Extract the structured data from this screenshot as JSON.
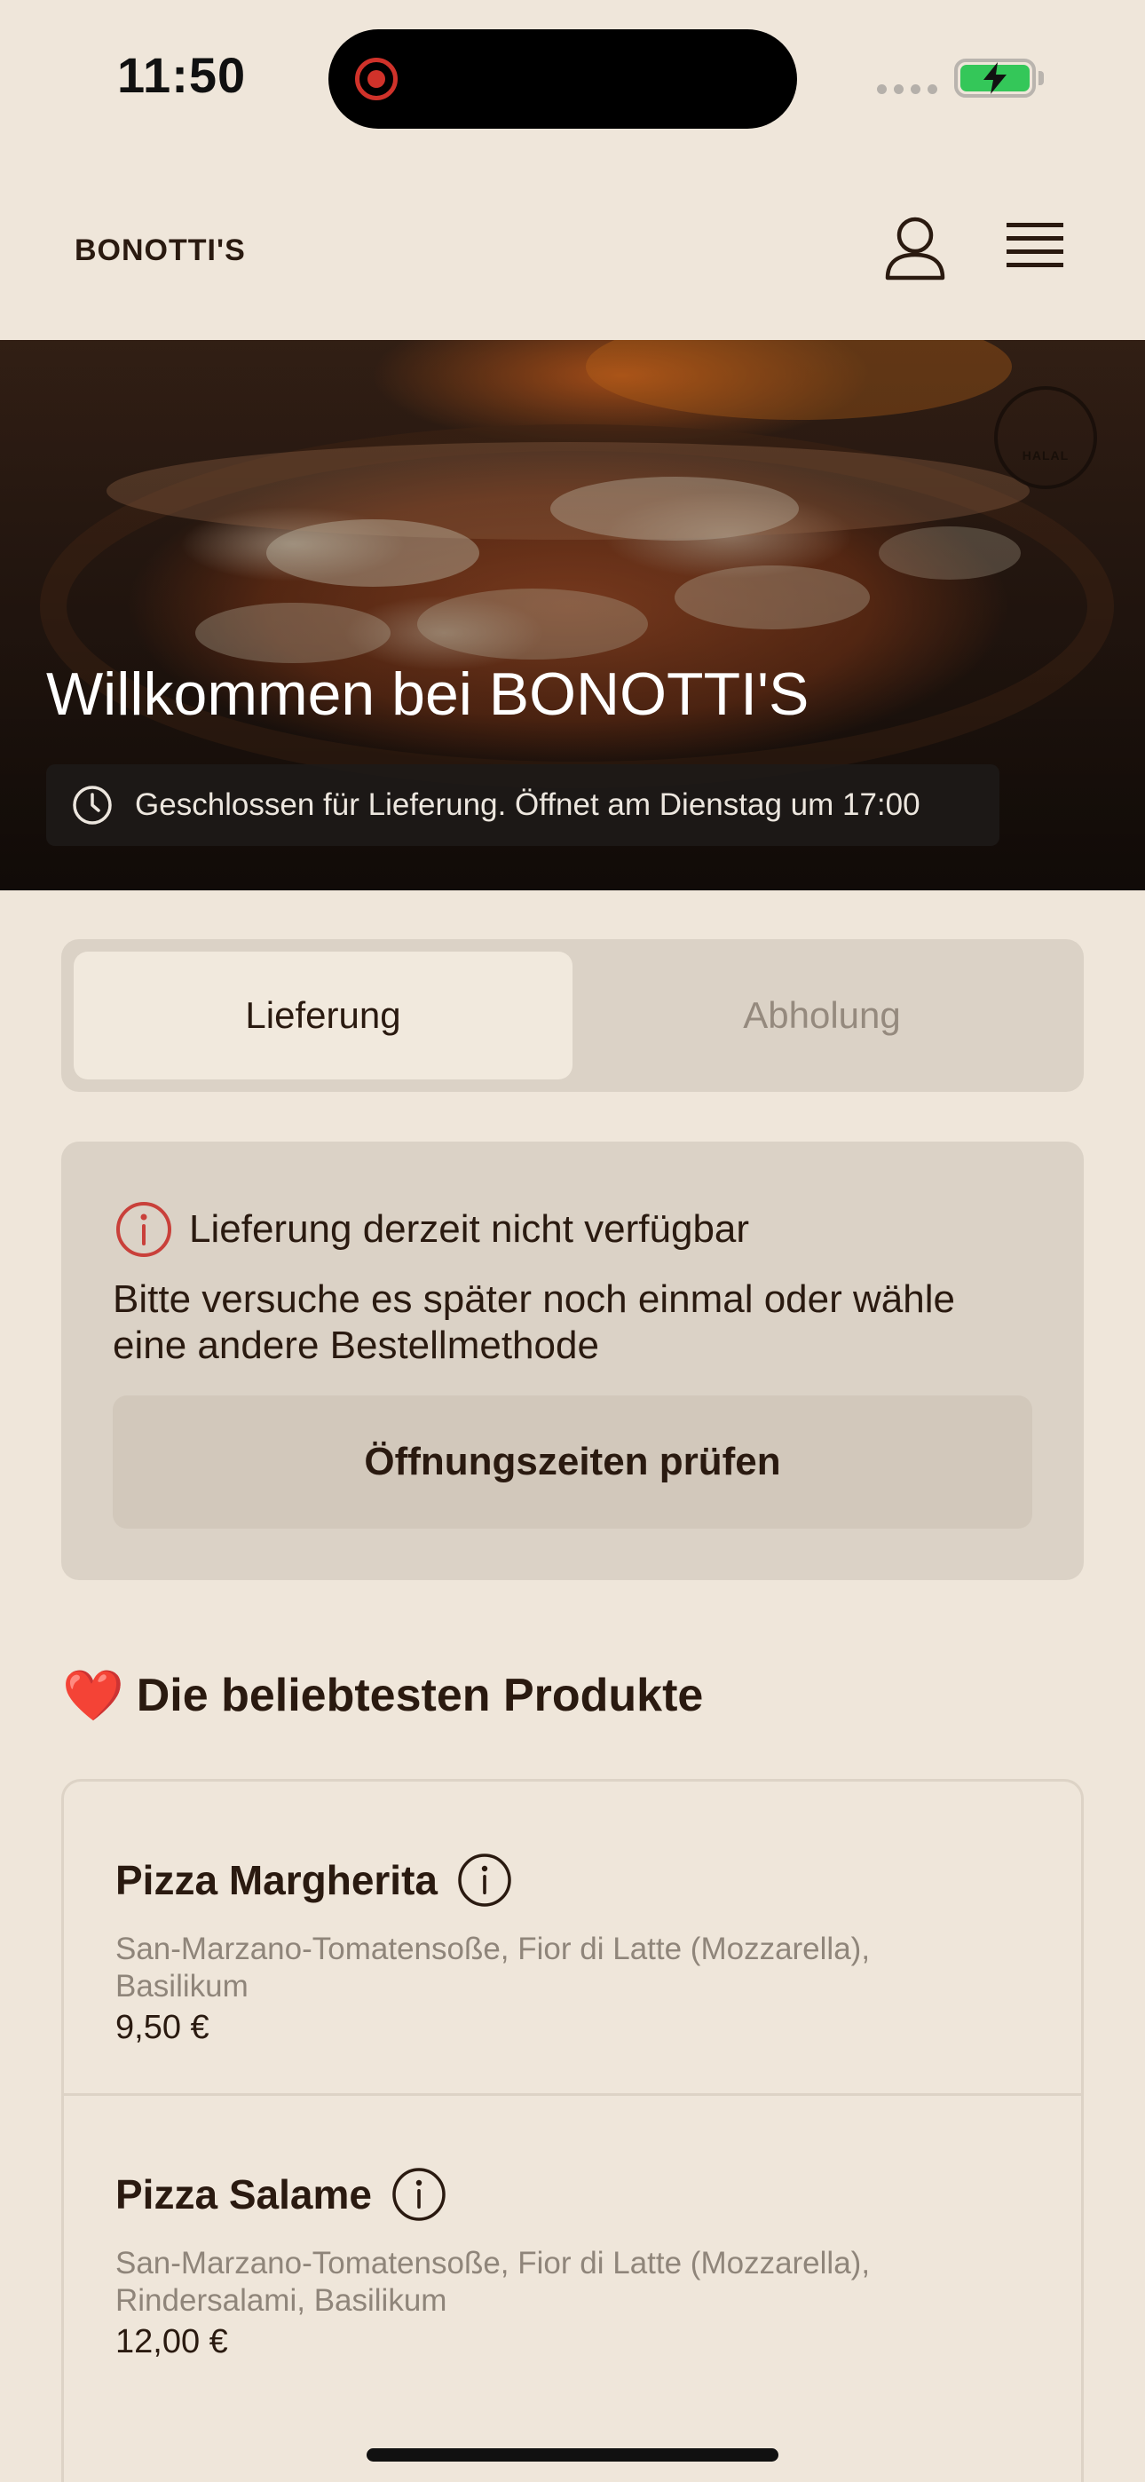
{
  "status_bar": {
    "time": "11:50"
  },
  "header": {
    "brand": "BONOTTI'S",
    "icons": [
      "user-icon",
      "menu-icon"
    ]
  },
  "hero": {
    "title": "Willkommen bei BONOTTI'S",
    "status": "Geschlossen für Lieferung. Öffnet am Dienstag um 17:00",
    "badge_icon": "halal-badge"
  },
  "order_mode": {
    "options": [
      "Lieferung",
      "Abholung"
    ],
    "selected": "Lieferung"
  },
  "notice": {
    "title": "Lieferung derzeit nicht verfügbar",
    "text": "Bitte versuche es später noch einmal oder wähle eine andere Bestellmethode",
    "button_label": "Öffnungszeiten prüfen"
  },
  "popular": {
    "emoji": "❤️",
    "title": "Die beliebtesten Produkte",
    "products": [
      {
        "name": "Pizza Margherita",
        "description": "San-Marzano-Tomatensoße, Fior di Latte (Mozzarella), Basilikum",
        "price": "9,50 €"
      },
      {
        "name": "Pizza Salame",
        "description": "San-Marzano-Tomatensoße, Fior di Latte (Mozzarella), Rindersalami, Basilikum",
        "price": "12,00 €"
      }
    ]
  },
  "colors": {
    "background": "#efe6da",
    "card": "#dbd2c6",
    "text": "#2a1a10",
    "muted": "#8f857a",
    "alert": "#c9403a"
  }
}
